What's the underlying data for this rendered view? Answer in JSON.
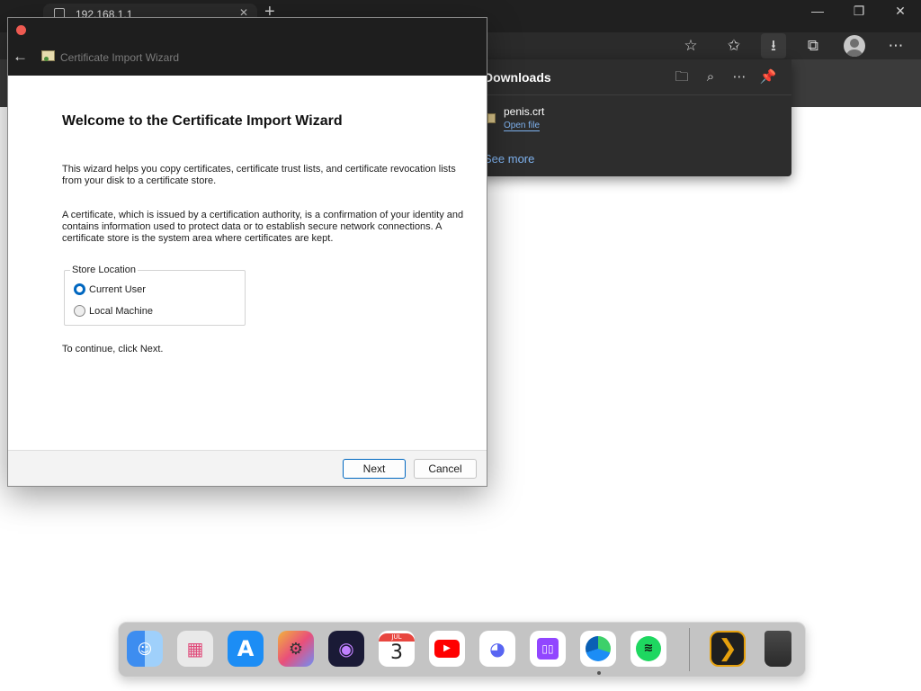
{
  "browser": {
    "tab_title": "192.168.1.1",
    "tab_close": "✕",
    "new_tab": "+",
    "window_controls": [
      "—",
      "❐",
      "✕"
    ],
    "toolbar_icons": [
      "favorite-star-add-icon",
      "favorites-icon",
      "download-icon",
      "collections-icon",
      "profile-avatar",
      "more-icon"
    ]
  },
  "downloads": {
    "title": "Downloads",
    "header_icons": [
      "folder-icon",
      "search-icon",
      "more-icon",
      "pin-icon"
    ],
    "file_name": "penis.crt",
    "open_file_label": "Open file",
    "see_more_label": "See more"
  },
  "wizard": {
    "window_title": "Certificate Import Wizard",
    "heading": "Welcome to the Certificate Import Wizard",
    "paragraph1": "This wizard helps you copy certificates, certificate trust lists, and certificate revocation lists from your disk to a certificate store.",
    "paragraph2": "A certificate, which is issued by a certification authority, is a confirmation of your identity and contains information used to protect data or to establish secure network connections. A certificate store is the system area where certificates are kept.",
    "store_location_label": "Store Location",
    "options": [
      {
        "label": "Current User",
        "selected": true
      },
      {
        "label": "Local Machine",
        "selected": false
      }
    ],
    "continue_text": "To continue, click Next.",
    "next_label": "Next",
    "cancel_label": "Cancel"
  },
  "dock": {
    "apps": [
      "Finder",
      "Launchpad",
      "App Store",
      "System Preferences",
      "Siri",
      "Calendar",
      "YouTube",
      "Discord",
      "Twitch",
      "Microsoft Edge",
      "Spotify",
      "Plex",
      "Trash"
    ],
    "calendar_month": "JUL",
    "calendar_day": "3"
  },
  "colors": {
    "accent_blue": "#0067c0",
    "link_blue": "#7fb3f0",
    "close_red": "#ee5a51"
  }
}
